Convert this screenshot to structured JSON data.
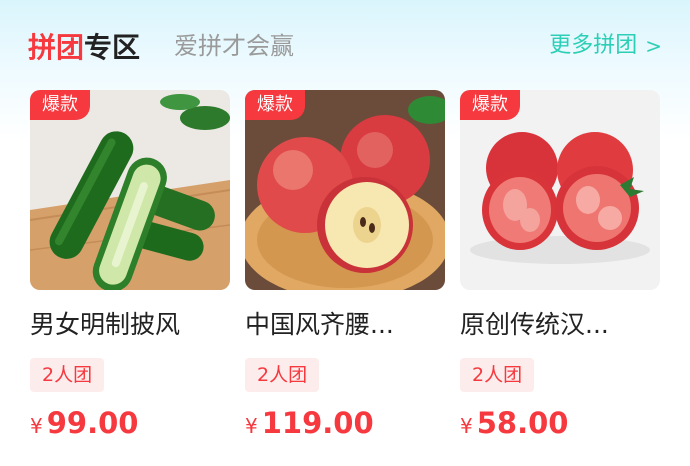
{
  "header": {
    "brand_part1": "拼团",
    "brand_part2": "专区",
    "slogan": "爱拼才会赢",
    "more_label": "更多拼团",
    "more_arrow": ">"
  },
  "products": [
    {
      "tag": "爆款",
      "name": "男女明制披风",
      "badge": "2人团",
      "currency": "¥",
      "price": "99.00",
      "image": "cucumber-image"
    },
    {
      "tag": "爆款",
      "name": "中国风齐腰...",
      "badge": "2人团",
      "currency": "¥",
      "price": "119.00",
      "image": "apple-image"
    },
    {
      "tag": "爆款",
      "name": "原创传统汉...",
      "badge": "2人团",
      "currency": "¥",
      "price": "58.00",
      "image": "tomato-image"
    }
  ],
  "colors": {
    "accent_red": "#f5393f",
    "accent_teal": "#2ccfb6"
  }
}
